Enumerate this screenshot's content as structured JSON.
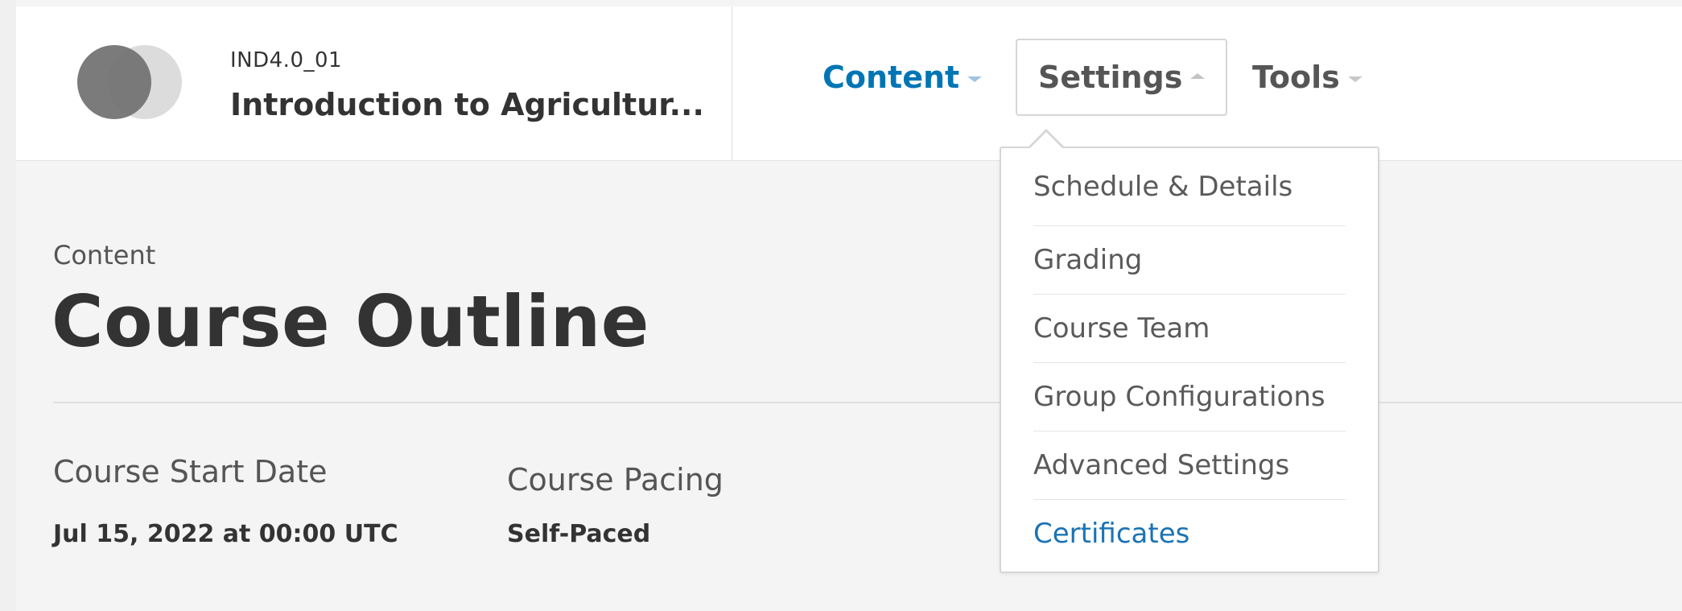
{
  "header": {
    "course_org": "IND4.0_01",
    "course_title": "Introduction to Agricultur..."
  },
  "nav": {
    "content_label": "Content",
    "settings_label": "Settings",
    "tools_label": "Tools"
  },
  "settings_menu": {
    "items": [
      {
        "label": "Schedule & Details"
      },
      {
        "label": "Grading"
      },
      {
        "label": "Course Team"
      },
      {
        "label": "Group Configurations"
      },
      {
        "label": "Advanced Settings"
      },
      {
        "label": "Certificates"
      }
    ]
  },
  "main": {
    "breadcrumb": "Content",
    "title": "Course Outline",
    "start_date_label": "Course Start Date",
    "start_date_value": "Jul 15, 2022 at 00:00 UTC",
    "pacing_label": "Course Pacing",
    "pacing_value": "Self-Paced"
  },
  "colors": {
    "accent": "#0075b4",
    "link": "#1a73b5",
    "background": "#f4f4f4"
  }
}
